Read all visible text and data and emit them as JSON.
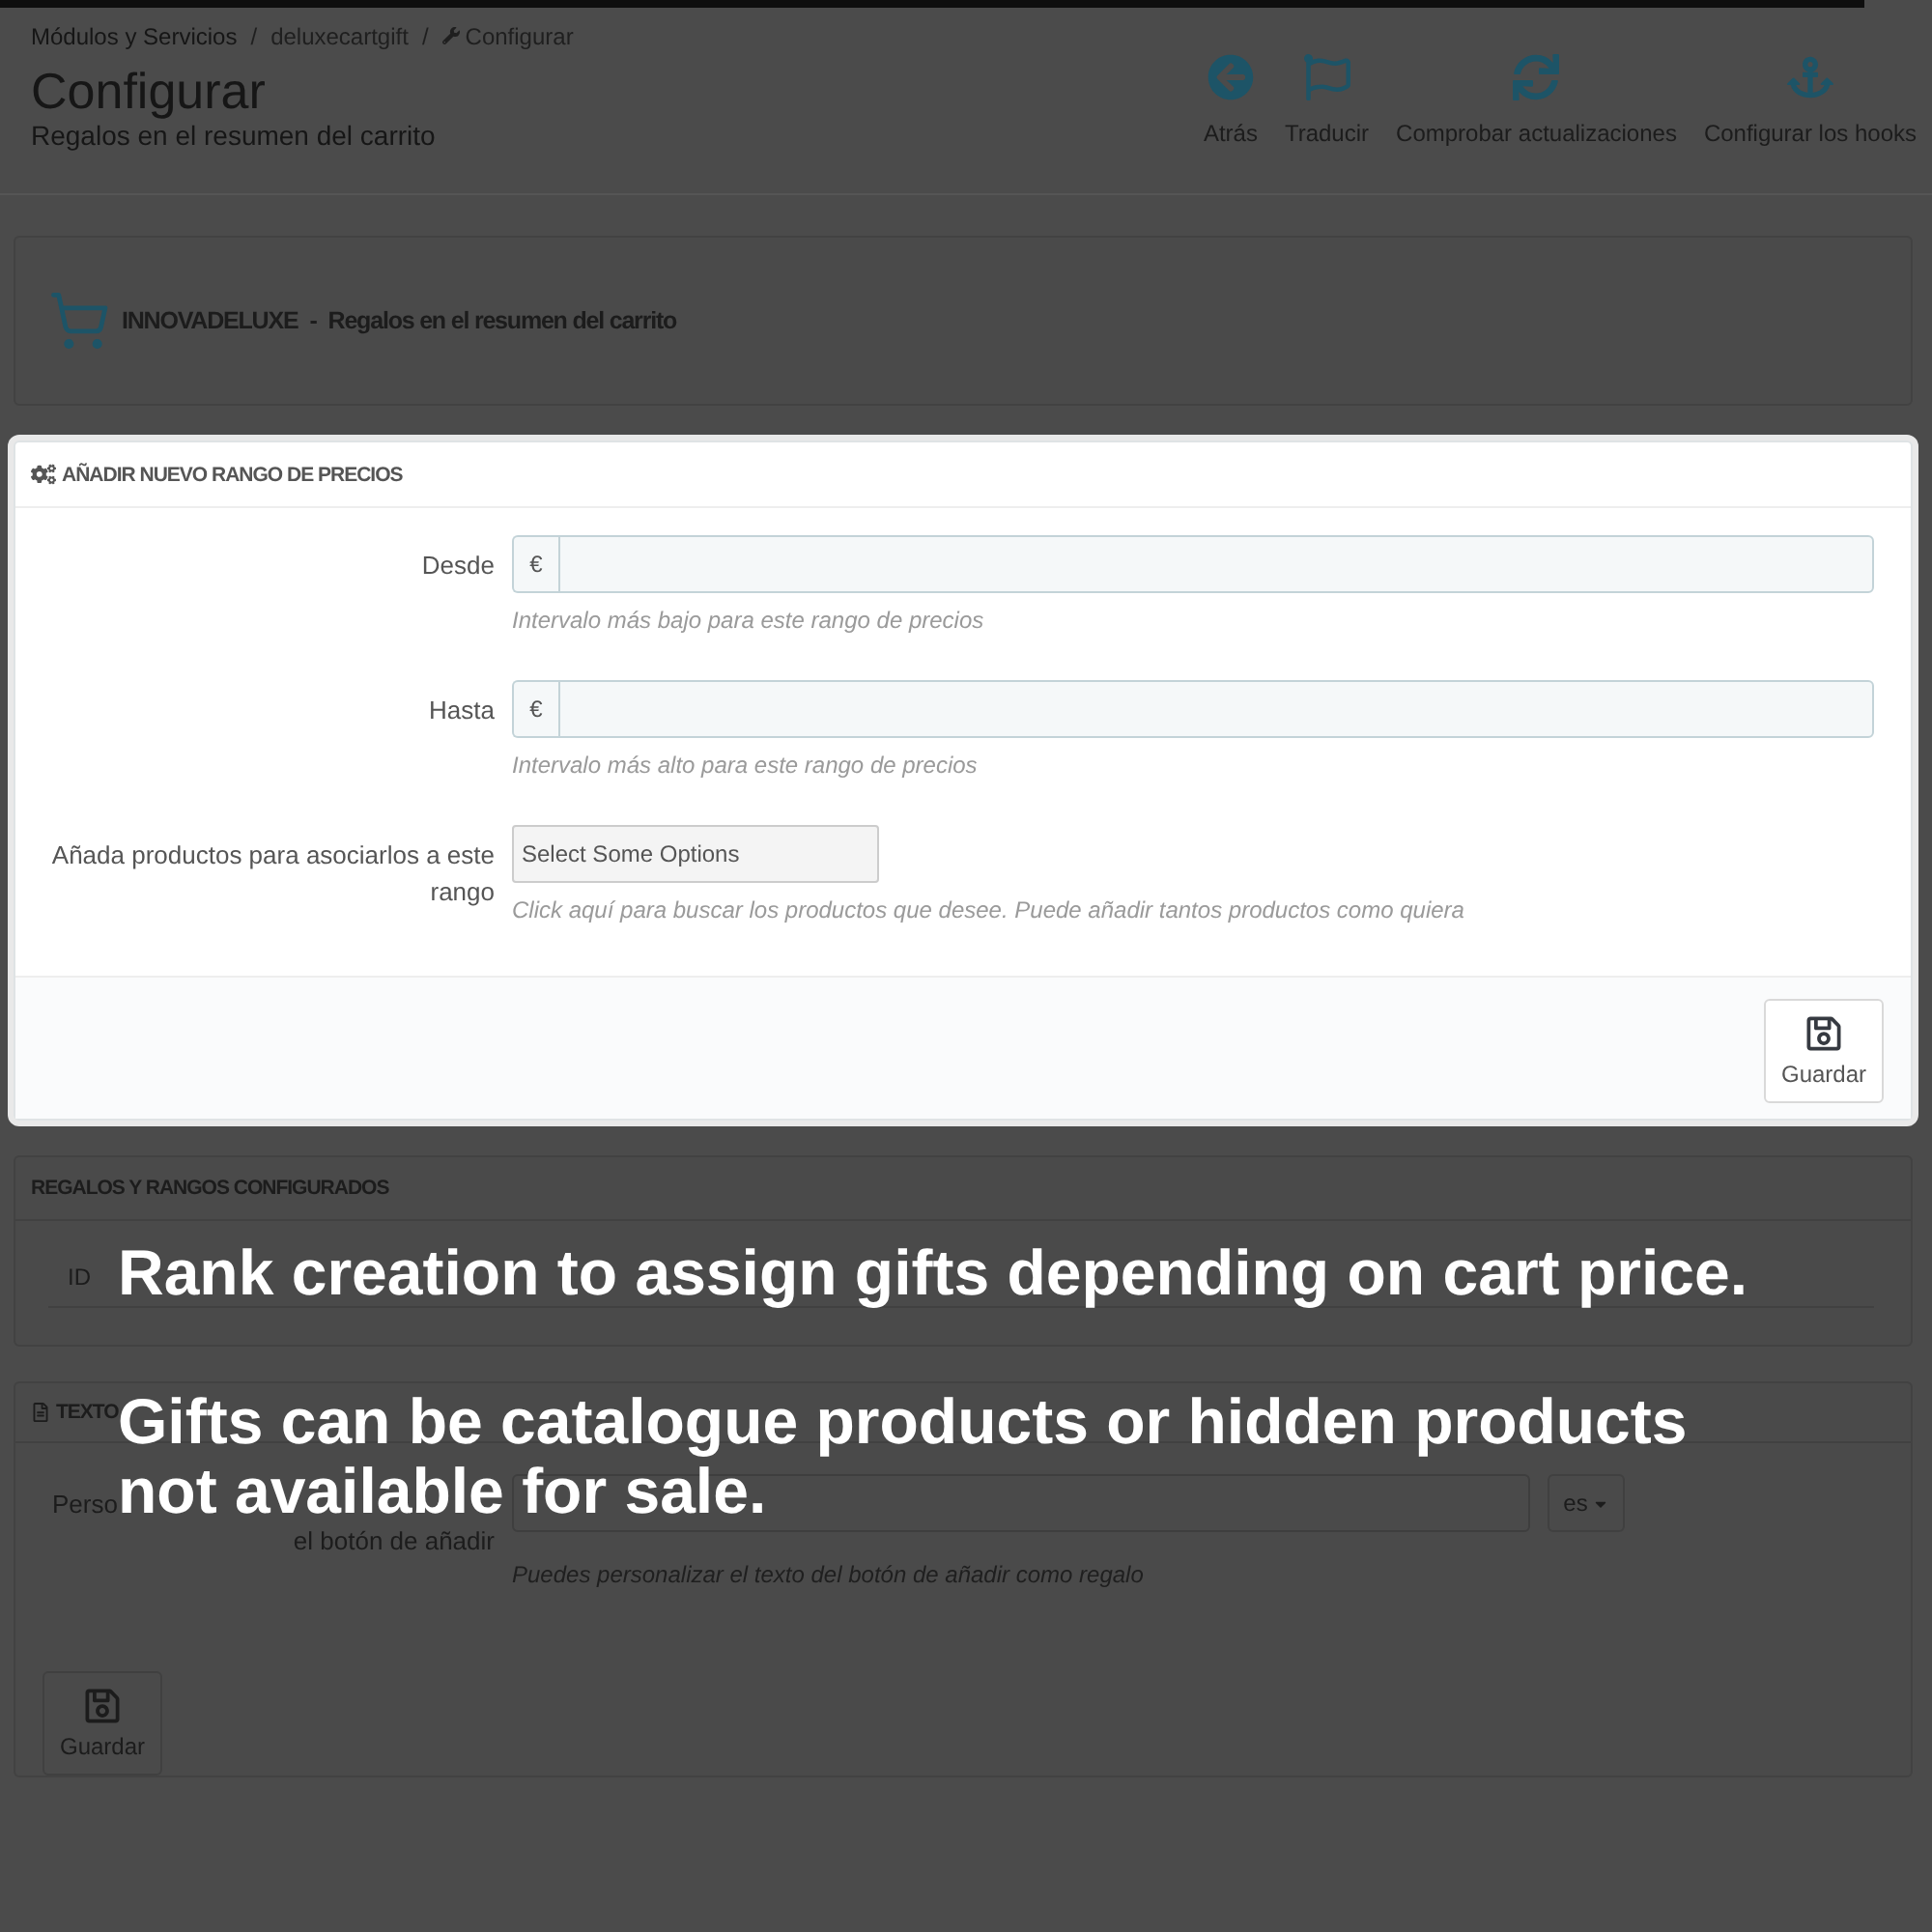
{
  "header": {
    "highlighted": false,
    "breadcrumb": [
      {
        "kind": "link",
        "label": "Módulos y Servicios"
      },
      {
        "kind": "separator",
        "label": "/"
      },
      {
        "kind": "muted",
        "label": "deluxecartgift"
      },
      {
        "kind": "separator",
        "label": "/"
      },
      {
        "kind": "current",
        "label": "Configurar"
      }
    ],
    "title": "Configurar",
    "subtitle": "Regalos en el resumen del carrito",
    "toolbar": [
      {
        "kind": "back",
        "label": "Atrás"
      },
      {
        "kind": "translate",
        "label": "Traducir"
      },
      {
        "kind": "update",
        "label": "Comprobar actualizaciones"
      },
      {
        "kind": "hooks",
        "label": "Configurar los hooks"
      }
    ]
  },
  "module_banner": {
    "highlighted": false,
    "brand": "INNOVADELUXE",
    "separator": "-",
    "name": "Regalos en el resumen del carrito"
  },
  "range_form": {
    "highlighted": true,
    "title": "AÑADIR NUEVO RANGO DE PRECIOS",
    "fields": [
      {
        "kind": "money",
        "label": "Desde",
        "prefix": "€",
        "help": "Intervalo más bajo para este rango de precios"
      },
      {
        "kind": "money",
        "label": "Hasta",
        "prefix": "€",
        "help": "Intervalo más alto para este rango de precios"
      },
      {
        "kind": "select",
        "label": "Añada productos para asociarlos a este rango",
        "placeholder": "Select Some Options",
        "help": "Click aquí para buscar los productos que desee. Puede añadir tantos productos como quiera"
      }
    ],
    "save_label": "Guardar"
  },
  "gifts_table": {
    "highlighted": false,
    "title": "REGALOS Y RANGOS CONFIGURADOS",
    "columns": [
      "ID"
    ]
  },
  "button_text_form": {
    "highlighted": false,
    "title": "TEXTO",
    "label_lines": [
      "Perso",
      "el botón de añadir"
    ],
    "language": "es",
    "help": "Puedes personalizar el texto del botón de añadir como regalo",
    "save_label": "Guardar"
  },
  "captions": [
    {
      "lines": [
        "Rank creation to assign gifts depending on cart price."
      ]
    },
    {
      "lines": [
        "Gifts can be catalogue products or hidden products",
        "not available for sale."
      ]
    }
  ]
}
